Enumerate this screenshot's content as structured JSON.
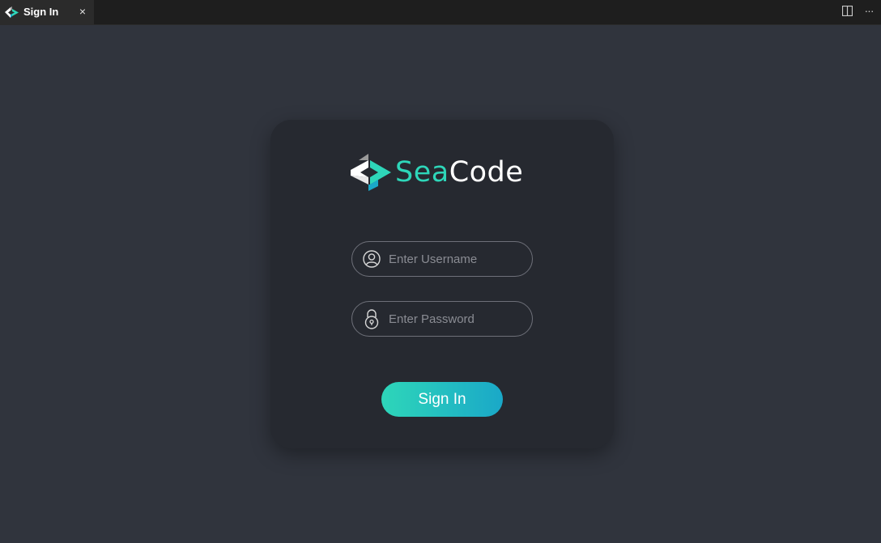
{
  "tab": {
    "title": "Sign In",
    "close_glyph": "×",
    "icon": "seacode-logo-icon"
  },
  "window_actions": {
    "split_icon": "split-editor-icon",
    "more_glyph": "···"
  },
  "login": {
    "brand_part1": "Sea",
    "brand_part2": "Code",
    "username_placeholder": "Enter Username",
    "password_placeholder": "Enter Password",
    "signin_label": "Sign In"
  },
  "colors": {
    "background": "#30343d",
    "card": "#262930",
    "accent_start": "#2ed6b9",
    "accent_end": "#1aa8c8"
  }
}
